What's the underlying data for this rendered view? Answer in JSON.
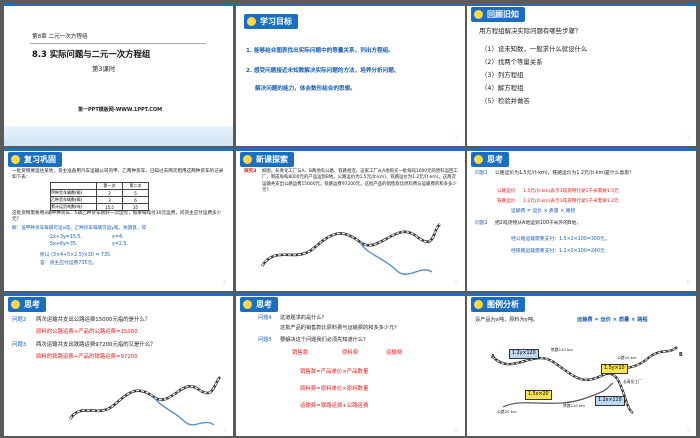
{
  "colors": {
    "accent": "#1a6fc1",
    "red": "#d22020",
    "bg": "#5a5a5a"
  },
  "slide_numbers": [
    "1",
    "2",
    "3",
    "4",
    "5",
    "6",
    "7",
    "8",
    "9"
  ],
  "s1": {
    "chapter": "第8章  二元一次方程组",
    "title": "8.3 实际问题与二元一次方程组",
    "subtitle": "第3课时",
    "footer": "第一PPT模板网-WWW.1PPT.COM"
  },
  "s2": {
    "heading": "学习目标",
    "goal1": "1. 能够结合图表找出实际问题中的等量关系，列出方程组。",
    "goal2a": "2. 感受问题接近未知数解决实际问题的方法，培养分析问题、",
    "goal2b": "解决问题的能力，体会数形结合的思想。"
  },
  "s3": {
    "heading": "回顾旧知",
    "question": "用方程组解决实际问题有哪些步骤？",
    "steps": [
      "（1）设未知数，一般求什么就设什么",
      "（2）找两个等量关系",
      "（3）列方程组",
      "（4）解方程组",
      "（5）检验并做答"
    ]
  },
  "s4": {
    "heading": "复习巩固",
    "para1": "一批货物要运往某地，货主准备用汽车运输公司的甲、乙两种货车，已知过去两次租用这两种货车的记录如下表：",
    "table_headers": [
      "",
      "第一次",
      "第二次"
    ],
    "table_rows": [
      [
        "甲种货车辆数(辆)",
        "2",
        "5"
      ],
      [
        "乙种货车辆数(辆)",
        "3",
        "6"
      ],
      [
        "累计运货吨数(吨)",
        "15.5",
        "35"
      ]
    ],
    "para2": "这批货物需要用3辆甲种货车、5辆乙种货车刚好一次运完，如果每吨付30元运费，问货主应付运费多少元？",
    "solve": "解：设甲种货车每辆可运x吨，乙种货车每辆可运y吨，依题意，得",
    "eq1": "2x+3y=15.5,",
    "eq2": "5x+6y=35.",
    "sol1": "x=4,",
    "sol2": "y=2.5.",
    "calc": "所以 (3×4+5×2.5)×30 = 735",
    "answer": "答：货主应付运费735元。"
  },
  "s5": {
    "heading": "新课探索",
    "label": "探究3",
    "text": "如图，长青化工厂与A、B两地有公路、铁路相连。这家工厂从A地购买一批每吨1000元的原料运回工厂，制成每吨8000元的产品运到B地。公路运价为1.5元/(t·km)，铁路运价为1.2元/(t·km)，这两次运输共支出公路运费15000元，铁路运费97200元。这批产品的销售款比原料费与运输费的和多多少元？"
  },
  "s6": {
    "heading": "思考",
    "q1_label": "问题1",
    "q1": "公路运价为1.5元/(t·km)，铁路运价为1.2元/(t·km)是什么意思？",
    "box1_title": "公路运价",
    "box1": "1.5元/(t·km)表示1吨货物行驶1千米需要1.5元",
    "box2_title": "铁路运价",
    "box2": "1.2元/(t·km)表示1吨货物行驶1千米需要1.2元",
    "formula": "运输费 = 运价 × 质量 × 路程",
    "q2_label": "问题2",
    "q2": "把2吨货物从A地运到100千米外的B地，",
    "r1": "经公路运输需要支付：1.5×2×100=300元。",
    "r2": "经铁路运输需要支付：1.2×2×100=240元"
  },
  "s7": {
    "heading": "思考",
    "q1_label": "问题2",
    "q1": "两次运输共支出公路运费15000元指的是什么？",
    "a1": "原料的公路运费+产品的公路运费=15000",
    "q2_label": "问题3",
    "q2": "两次运输共支出铁路运费97200元指的又是什么？",
    "a2": "原料的铁路运费+产品的铁路运费=97200"
  },
  "s8": {
    "heading": "思考",
    "q4_label": "问题4",
    "q4": "这道题求的是什么？",
    "q4b": "这批产品的销售款比原料费与运输费的和多多少元？",
    "q5_label": "问题5",
    "q5": "要解决这个问题我们必须先知道什么？",
    "t1": "销售款",
    "t2": "原料费",
    "t3": "运输费",
    "f1": "销售款=产品单价×产品数量",
    "f2": "原料费=原料单价×原料数量",
    "f3": "运输费=铁路运费+公路运费"
  },
  "s9": {
    "heading": "图例分析",
    "intro": "设产品为x吨，原料为y吨。",
    "formula": "运输费 = 运价 × 质量 × 路程",
    "b1": "1.2y×120",
    "b2": "1.5x×20",
    "b3": "1.5y×10",
    "b4": "1.2x×110",
    "l1": "铁路120 km",
    "l2": "公路10 km",
    "l3": "公路20 km",
    "l4": "铁路110 km",
    "a": "A",
    "b": "B",
    "factory": "长青化工厂"
  }
}
